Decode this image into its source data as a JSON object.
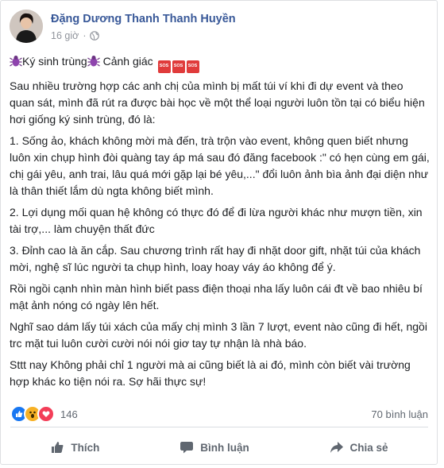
{
  "post": {
    "author": "Đặng Dương Thanh Thanh Huyền",
    "time": "16 giờ",
    "separator": "·",
    "title_text": "Ký sinh trùng",
    "title_text2": " Cảnh giác ",
    "sos_label": "SOS",
    "paragraphs": [
      "Sau nhiều trường hợp các anh chị của mình bị mất túi ví khi đi dự event và theo quan sát, mình đã rút ra được bài học về một thể loại người luôn tồn tại có biểu hiện hơi giống ký sinh trùng, đó là:",
      "1. Sống ảo, khách không mời mà đến, trà trộn vào event, không quen biết nhưng luôn xin chụp hình đòi quàng tay áp má sau đó đăng facebook :\" có hẹn cùng em gái, chị gái yêu, anh trai, lâu quá mới gặp lại bé yêu,...\" đổi luôn ảnh bìa ảnh đại diện như là thân thiết lắm dù ngta không biết mình.",
      "2. Lợi dụng mối quan hệ không có thực đó để đi lừa người khác như mượn tiền, xin tài trợ,... làm chuyện thất đức",
      "3. Đỉnh cao là ăn cắp. Sau chương trình rất hay đi nhặt door gift, nhặt túi của khách mời, nghệ sĩ lúc người ta chụp hình, loay hoay váy áo không để ý.",
      "Rồi ngồi cạnh nhìn màn hình biết pass điện thoại nha lấy luôn cái đt về bao nhiêu bí mật ảnh nóng có ngày lên hết.",
      "Nghĩ sao dám lấy túi xách của mấy chị mình 3 lần 7 lượt, event nào cũng đi hết, ngồi trc mặt tui luôn cười cười nói nói giơ tay tự nhận là nhà báo.",
      "Sttt nay Không phải chỉ 1 người mà ai cũng biết là ai đó, mình còn biết vài trường hợp khác ko tiện nói ra. Sợ hãi thực sự!"
    ]
  },
  "reactions": {
    "count": "146",
    "comments": "70 bình luận",
    "types": [
      "like",
      "wow",
      "love"
    ]
  },
  "actions": {
    "like": "Thích",
    "comment": "Bình luận",
    "share": "Chia sẻ"
  },
  "colors": {
    "author": "#385898",
    "like_blue": "#1877f2",
    "love_red": "#f33e58",
    "wow_yellow": "#f7b125",
    "sos_red": "#e03b3b"
  }
}
